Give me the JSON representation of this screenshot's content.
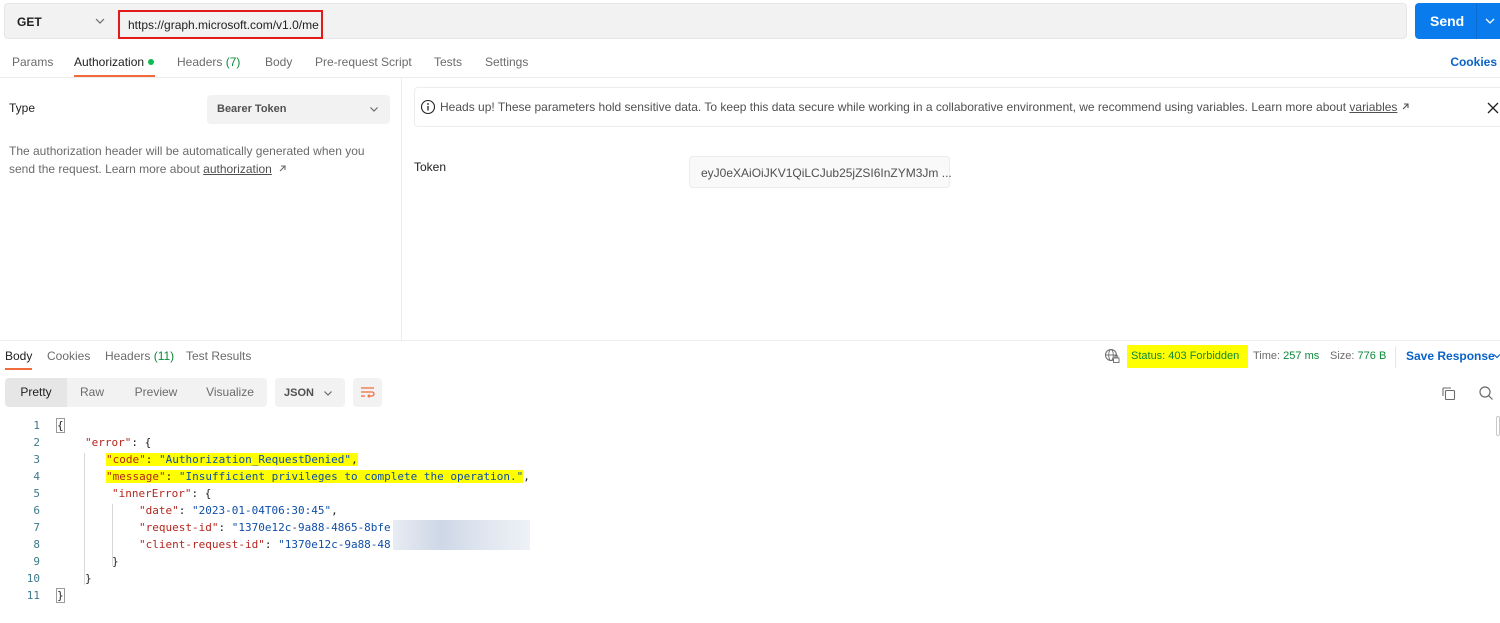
{
  "request": {
    "method": "GET",
    "url": "https://graph.microsoft.com/v1.0/me",
    "send_label": "Send"
  },
  "request_tabs": [
    {
      "label": "Params"
    },
    {
      "label": "Authorization",
      "active": true,
      "indicator": "green-dot"
    },
    {
      "label": "Headers",
      "count": "(7)"
    },
    {
      "label": "Body"
    },
    {
      "label": "Pre-request Script"
    },
    {
      "label": "Tests"
    },
    {
      "label": "Settings"
    }
  ],
  "cookies_label": "Cookies",
  "auth": {
    "type_label": "Type",
    "type_value": "Bearer Token",
    "description": "The authorization header will be automatically generated when you send the request. Learn more about ",
    "description_link": "authorization",
    "banner_text": "Heads up! These parameters hold sensitive data. To keep this data secure while working in a collaborative environment, we recommend using variables. Learn more about ",
    "banner_link": "variables",
    "token_label": "Token",
    "token_value": "eyJ0eXAiOiJKV1QiLCJub25jZSI6InZYM3Jm ..."
  },
  "response_tabs": [
    {
      "label": "Body",
      "active": true
    },
    {
      "label": "Cookies"
    },
    {
      "label": "Headers",
      "count": "(11)"
    },
    {
      "label": "Test Results"
    }
  ],
  "response_meta": {
    "status": "Status: 403 Forbidden",
    "time_label": "Time:",
    "time_value": "257 ms",
    "size_label": "Size:",
    "size_value": "776 B",
    "save_label": "Save Response"
  },
  "view_modes": [
    {
      "label": "Pretty",
      "active": true
    },
    {
      "label": "Raw"
    },
    {
      "label": "Preview"
    },
    {
      "label": "Visualize"
    }
  ],
  "format": "JSON",
  "icons": {
    "method_dropdown": "chevron-down-icon",
    "send_dropdown": "chevron-down-icon",
    "banner": "info-icon",
    "banner_close": "close-icon",
    "external_link": "arrow-up-right-icon",
    "network": "globe-lock-icon",
    "wrap": "wrap-lines-icon",
    "copy": "copy-icon",
    "search": "search-icon"
  },
  "colors": {
    "send_button": "#097bed",
    "active_tab_underline": "#f26b3a",
    "status_highlight": "#ffff00",
    "status_green": "#0c8a3a",
    "url_highlight_border": "#e21a1a",
    "json_key": "#b3261e",
    "json_string": "#0f4ea8"
  },
  "response_body": {
    "line_numbers": [
      "1",
      "2",
      "3",
      "4",
      "5",
      "6",
      "7",
      "8",
      "9",
      "10",
      "11"
    ],
    "lines": {
      "l1": "{",
      "l2_key": "\"error\"",
      "l2_rest": ": {",
      "l3_key": "\"code\"",
      "l3_val": "\"Authorization_RequestDenied\"",
      "l4_key": "\"message\"",
      "l4_val": "\"Insufficient privileges to complete the operation.\"",
      "l5_key": "\"innerError\"",
      "l5_rest": ": {",
      "l6_key": "\"date\"",
      "l6_val": "\"2023-01-04T06:30:45\"",
      "l7_key": "\"request-id\"",
      "l7_val": "\"1370e12c-9a88-4865-8bfe",
      "l8_key": "\"client-request-id\"",
      "l8_val": "\"1370e12c-9a88-48",
      "l9": "}",
      "l10": "}",
      "l11": "}"
    }
  }
}
